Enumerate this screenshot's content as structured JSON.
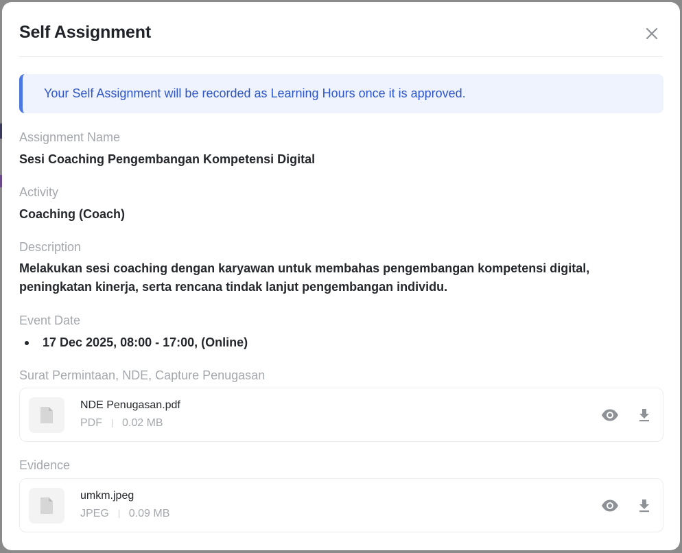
{
  "modal": {
    "title": "Self Assignment"
  },
  "banner": {
    "text": "Your Self Assignment will be recorded as Learning Hours once it is approved."
  },
  "fields": {
    "assignment_name": {
      "label": "Assignment Name",
      "value": "Sesi Coaching Pengembangan Kompetensi Digital"
    },
    "activity": {
      "label": "Activity",
      "value": "Coaching (Coach)"
    },
    "description": {
      "label": "Description",
      "value": "Melakukan sesi coaching dengan karyawan untuk membahas pengembangan kompetensi digital, peningkatan kinerja, serta rencana tindak lanjut pengembangan individu."
    },
    "event_date": {
      "label": "Event Date",
      "items": [
        "17 Dec 2025, 08:00 - 17:00, (Online)"
      ]
    }
  },
  "attachments": {
    "label": "Surat Permintaan, NDE, Capture Penugasan",
    "file": {
      "name": "NDE Penugasan.pdf",
      "type": "PDF",
      "size": "0.02 MB"
    }
  },
  "evidence": {
    "label": "Evidence",
    "file": {
      "name": "umkm.jpeg",
      "type": "JPEG",
      "size": "0.09 MB"
    }
  },
  "icons": {
    "close": "close-icon",
    "file": "file-icon",
    "view": "eye-icon",
    "download": "download-icon"
  },
  "colors": {
    "accent": "#4a78e0",
    "banner_bg": "#eef3fd",
    "banner_text": "#2f56c6",
    "muted_label": "#a4a8ad",
    "icon_gray": "#8e9196"
  }
}
